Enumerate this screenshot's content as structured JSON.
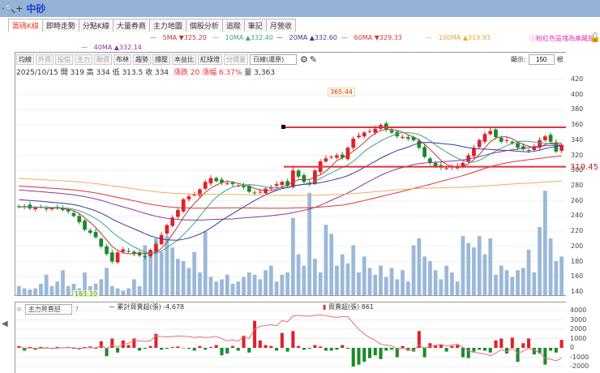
{
  "app": {
    "title": "中砂",
    "zoom_icon": "magnifier-plus-icon"
  },
  "tabs": [
    "籌碼K線",
    "即時走勢",
    "分點K線",
    "大量券商",
    "主力地圖",
    "個股分析",
    "追蹤",
    "筆記",
    "月營收"
  ],
  "ma_legend": [
    {
      "label": "5MA ▼325.20",
      "color": "#b33a3a"
    },
    {
      "label": "10MA ▲332.40",
      "color": "#3aa58c"
    },
    {
      "label": "20MA ▲332.60",
      "color": "#3a3a9c"
    },
    {
      "label": "60MA ▼329.33",
      "color": "#e0323a"
    },
    {
      "label": "100MA ▲319.93",
      "color": "#e8a93a"
    },
    {
      "label": "40MA ▲332.14",
      "color": "#8a3a9c"
    }
  ],
  "notice": "ⓘ粉紅色區塊為庫藏股",
  "toolbar": {
    "buttons": [
      "均線",
      "外資",
      "投信",
      "主力",
      "融資",
      "布林",
      "趨勢",
      "撐壓",
      "本益比",
      "紅綠燈",
      "分價量"
    ],
    "dim": [
      1,
      2,
      3,
      4,
      10
    ],
    "period": "日線(還原)",
    "display_label": "顯示:",
    "display_value": "150",
    "display_unit": "根"
  },
  "info": {
    "date": "2025/10/15",
    "open": "開 319",
    "high": "高 334",
    "low": "低 313.5",
    "close": "收 334",
    "change": "漲跌 20",
    "pct": "漲幅 6.37%",
    "volume": "量 3,363"
  },
  "chart_data": {
    "type": "candlestick",
    "y_ticks": [
      420,
      400,
      380,
      360,
      340,
      320,
      300,
      280,
      260,
      240,
      220,
      200,
      180,
      160,
      140
    ],
    "ylim": [
      133,
      425
    ],
    "annotations": {
      "high": "365.44",
      "low": "163.10",
      "support": "319.45",
      "resistance_level": 357,
      "support_level": 305
    },
    "closes": [
      252,
      253,
      250,
      251,
      252,
      249,
      250,
      251,
      248,
      246,
      240,
      232,
      222,
      218,
      212,
      200,
      190,
      180,
      192,
      196,
      193,
      190,
      188,
      186,
      195,
      203,
      215,
      228,
      238,
      248,
      262,
      266,
      268,
      275,
      285,
      290,
      286,
      284,
      283,
      282,
      280,
      278,
      272,
      270,
      272,
      276,
      278,
      282,
      285,
      280,
      300,
      292,
      285,
      282,
      300,
      312,
      316,
      318,
      320,
      317,
      330,
      342,
      346,
      350,
      352,
      355,
      360,
      354,
      350,
      345,
      344,
      342,
      340,
      330,
      318,
      310,
      305,
      304,
      303,
      305,
      306,
      310,
      320,
      330,
      340,
      348,
      352,
      344,
      338,
      340,
      336,
      330,
      328,
      326,
      332,
      340,
      345,
      338,
      325,
      334
    ],
    "volumes": [
      8,
      6,
      5,
      6,
      10,
      18,
      8,
      12,
      22,
      8,
      10,
      6,
      20,
      8,
      10,
      14,
      24,
      8,
      6,
      4,
      6,
      14,
      8,
      44,
      40,
      50,
      38,
      52,
      42,
      32,
      30,
      24,
      38,
      20,
      56,
      16,
      12,
      14,
      18,
      10,
      12,
      16,
      20,
      18,
      14,
      22,
      26,
      12,
      18,
      20,
      68,
      36,
      26,
      90,
      32,
      20,
      62,
      54,
      26,
      36,
      28,
      44,
      20,
      34,
      24,
      18,
      26,
      16,
      24,
      14,
      22,
      12,
      44,
      50,
      34,
      30,
      22,
      14,
      26,
      20,
      12,
      52,
      46,
      42,
      52,
      36,
      50,
      18,
      26,
      22,
      16,
      22,
      24,
      40,
      20,
      60,
      92,
      50,
      30,
      34
    ],
    "flows": [
      200,
      -300,
      100,
      -200,
      100,
      50,
      -100,
      100,
      50,
      100,
      -100,
      -150,
      80,
      150,
      -100,
      700,
      -900,
      1000,
      -500,
      800,
      300,
      1000,
      -300,
      -100,
      200,
      1500,
      -200,
      -100,
      100,
      150,
      -50,
      -100,
      -300,
      200,
      -200,
      100,
      300,
      -800,
      -600,
      200,
      -300,
      1300,
      -500,
      2900,
      800,
      300,
      200,
      -300,
      1600,
      -400,
      1800,
      200,
      -200,
      -100,
      300,
      150,
      -300,
      -300,
      -200,
      300,
      -100,
      -2000,
      -1800,
      -1500,
      -1100,
      -800,
      -1200,
      -300,
      -200,
      -1000,
      200,
      -300,
      -400,
      1800,
      -1000,
      500,
      300,
      300,
      -400,
      200,
      300,
      -1000,
      -1100,
      -400,
      -200,
      -300,
      -500,
      800,
      1000,
      -600,
      1100,
      -1500,
      500,
      1000,
      -700,
      -600,
      -1800,
      -300,
      -500,
      861
    ],
    "flow_ticks": [
      4000,
      3000,
      2000,
      1000,
      0,
      -1000,
      -2000
    ]
  },
  "indicator": {
    "select": "主力買賣超",
    "help": "?",
    "cum_label": "累計買賣超(張) -4,678",
    "bar_label": "買賣超(張) 861"
  },
  "side": {
    "collapse": "◀"
  }
}
